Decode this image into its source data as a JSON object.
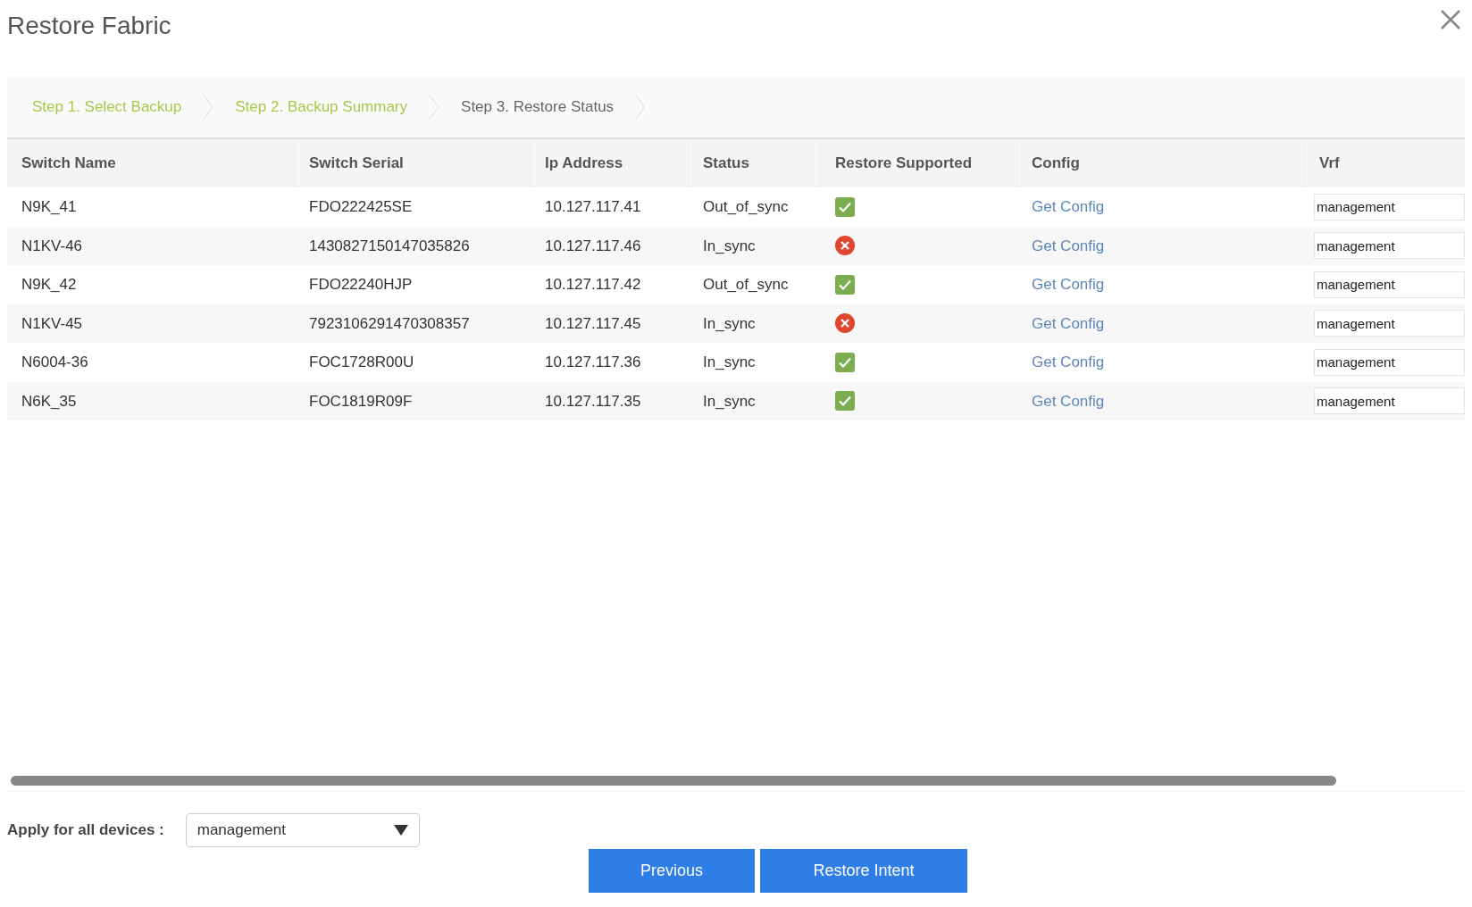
{
  "dialog": {
    "title": "Restore Fabric"
  },
  "steps": [
    {
      "label": "Step 1. Select Backup",
      "completed": true
    },
    {
      "label": "Step 2. Backup Summary",
      "completed": true
    },
    {
      "label": "Step 3. Restore Status",
      "completed": false
    }
  ],
  "table": {
    "columns": [
      "Switch Name",
      "Switch Serial",
      "Ip Address",
      "Status",
      "Restore Supported",
      "Config",
      "Vrf"
    ],
    "rows": [
      {
        "name": "N9K_41",
        "serial": "FDO222425SE",
        "ip": "10.127.117.41",
        "status": "Out_of_sync",
        "restore_supported": true,
        "config": "Get Config",
        "vrf": "management"
      },
      {
        "name": "N1KV-46",
        "serial": "1430827150147035826",
        "ip": "10.127.117.46",
        "status": "In_sync",
        "restore_supported": false,
        "config": "Get Config",
        "vrf": "management"
      },
      {
        "name": "N9K_42",
        "serial": "FDO22240HJP",
        "ip": "10.127.117.42",
        "status": "Out_of_sync",
        "restore_supported": true,
        "config": "Get Config",
        "vrf": "management"
      },
      {
        "name": "N1KV-45",
        "serial": "7923106291470308357",
        "ip": "10.127.117.45",
        "status": "In_sync",
        "restore_supported": false,
        "config": "Get Config",
        "vrf": "management"
      },
      {
        "name": "N6004-36",
        "serial": "FOC1728R00U",
        "ip": "10.127.117.36",
        "status": "In_sync",
        "restore_supported": true,
        "config": "Get Config",
        "vrf": "management"
      },
      {
        "name": "N6K_35",
        "serial": "FOC1819R09F",
        "ip": "10.127.117.35",
        "status": "In_sync",
        "restore_supported": true,
        "config": "Get Config",
        "vrf": "management"
      }
    ]
  },
  "apply_all": {
    "label": "Apply for all devices :",
    "value": "management"
  },
  "buttons": [
    "Previous",
    "Restore Intent"
  ]
}
